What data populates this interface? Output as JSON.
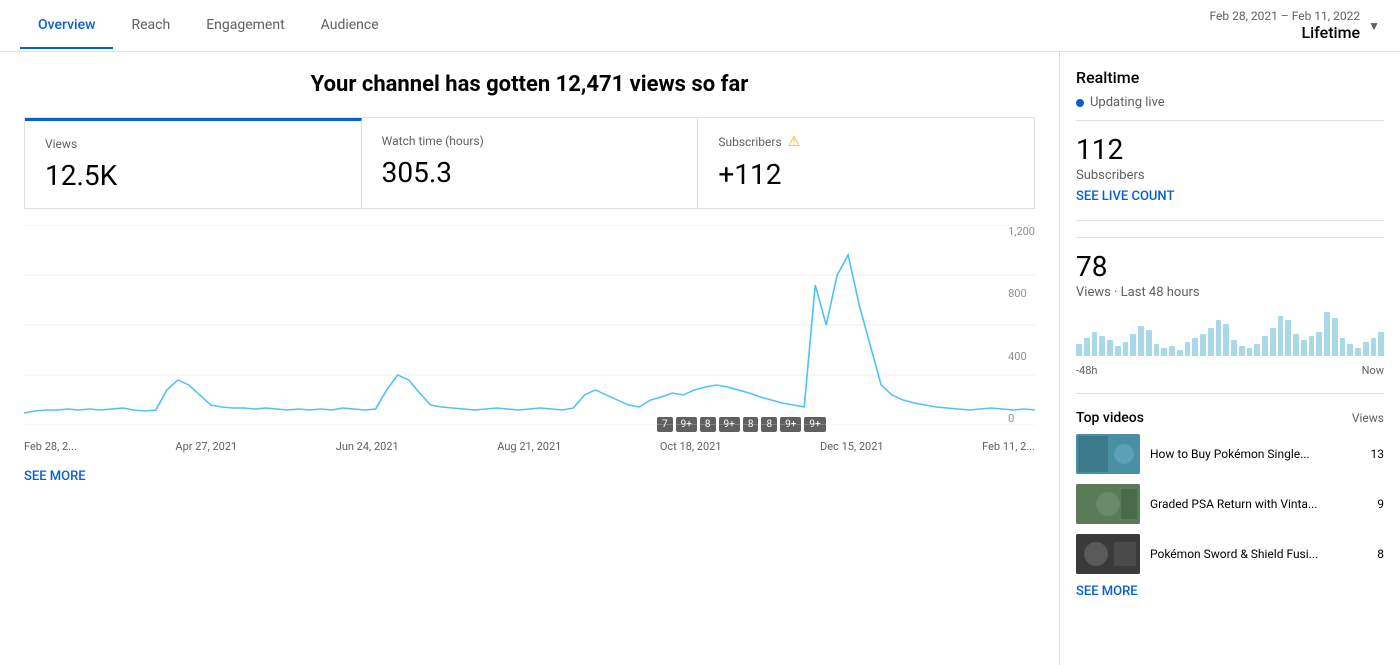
{
  "header": {
    "date_range_sub": "Feb 28, 2021 – Feb 11, 2022",
    "date_range_main": "Lifetime"
  },
  "nav": {
    "tabs": [
      {
        "label": "Overview",
        "active": true
      },
      {
        "label": "Reach",
        "active": false
      },
      {
        "label": "Engagement",
        "active": false
      },
      {
        "label": "Audience",
        "active": false
      }
    ]
  },
  "main": {
    "headline": "Your channel has gotten 12,471 views so far",
    "stats": [
      {
        "label": "Views",
        "value": "12.5K",
        "active": true
      },
      {
        "label": "Watch time (hours)",
        "value": "305.3",
        "active": false
      },
      {
        "label": "Subscribers",
        "value": "+112",
        "active": false,
        "warning": true
      }
    ],
    "chart": {
      "x_labels": [
        "Feb 28, 2...",
        "Apr 27, 2021",
        "Jun 24, 2021",
        "Aug 21, 2021",
        "Oct 18, 2021",
        "Dec 15, 2021",
        "Feb 11, 2..."
      ],
      "y_labels": [
        "1,200",
        "800",
        "400",
        "0"
      ]
    },
    "video_markers": [
      "7",
      "9+",
      "8",
      "9+",
      "8",
      "8",
      "9+",
      "9+"
    ],
    "see_more_label": "SEE MORE"
  },
  "sidebar": {
    "realtime": {
      "title": "Realtime",
      "updating": "Updating live",
      "subscribers_count": "112",
      "subscribers_label": "Subscribers",
      "see_live_count": "SEE LIVE COUNT"
    },
    "views": {
      "count": "78",
      "label": "Views · Last 48 hours",
      "chart_label_left": "-48h",
      "chart_label_right": "Now"
    },
    "top_videos": {
      "title": "Top videos",
      "views_col": "Views",
      "items": [
        {
          "title": "How to Buy Pokémon Single...",
          "views": "13",
          "thumb_bg": "#4a90a4"
        },
        {
          "title": "Graded PSA Return with Vinta...",
          "views": "9",
          "thumb_bg": "#5a7a5a"
        },
        {
          "title": "Pokémon Sword & Shield Fusi...",
          "views": "8",
          "thumb_bg": "#3a3a3a"
        }
      ]
    },
    "see_more_label": "SEE MORE"
  }
}
